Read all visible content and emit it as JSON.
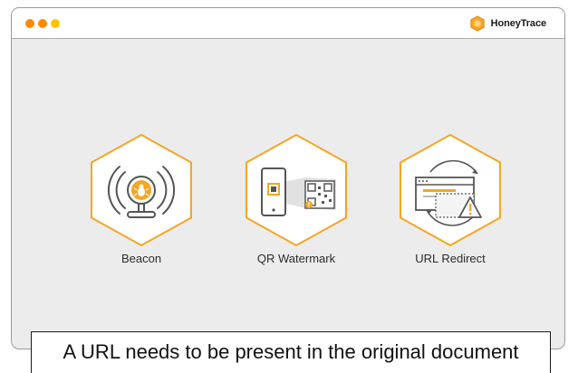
{
  "colors": {
    "accent": "#f5a623",
    "dot_1": "#ff8a00",
    "dot_2": "#ff8a00",
    "dot_3": "#ffc400"
  },
  "window": {
    "controls": [
      "close",
      "minimize",
      "maximize"
    ],
    "brand": {
      "logo_icon": "honeycomb-hexagon-icon",
      "name": "HoneyTrace"
    }
  },
  "features": [
    {
      "label": "Beacon",
      "icon": "beacon-bug-icon"
    },
    {
      "label": "QR Watermark",
      "icon": "qr-watermark-icon"
    },
    {
      "label": "URL Redirect",
      "icon": "url-redirect-icon"
    }
  ],
  "caption": {
    "text": "A URL needs to be present in the original document"
  }
}
